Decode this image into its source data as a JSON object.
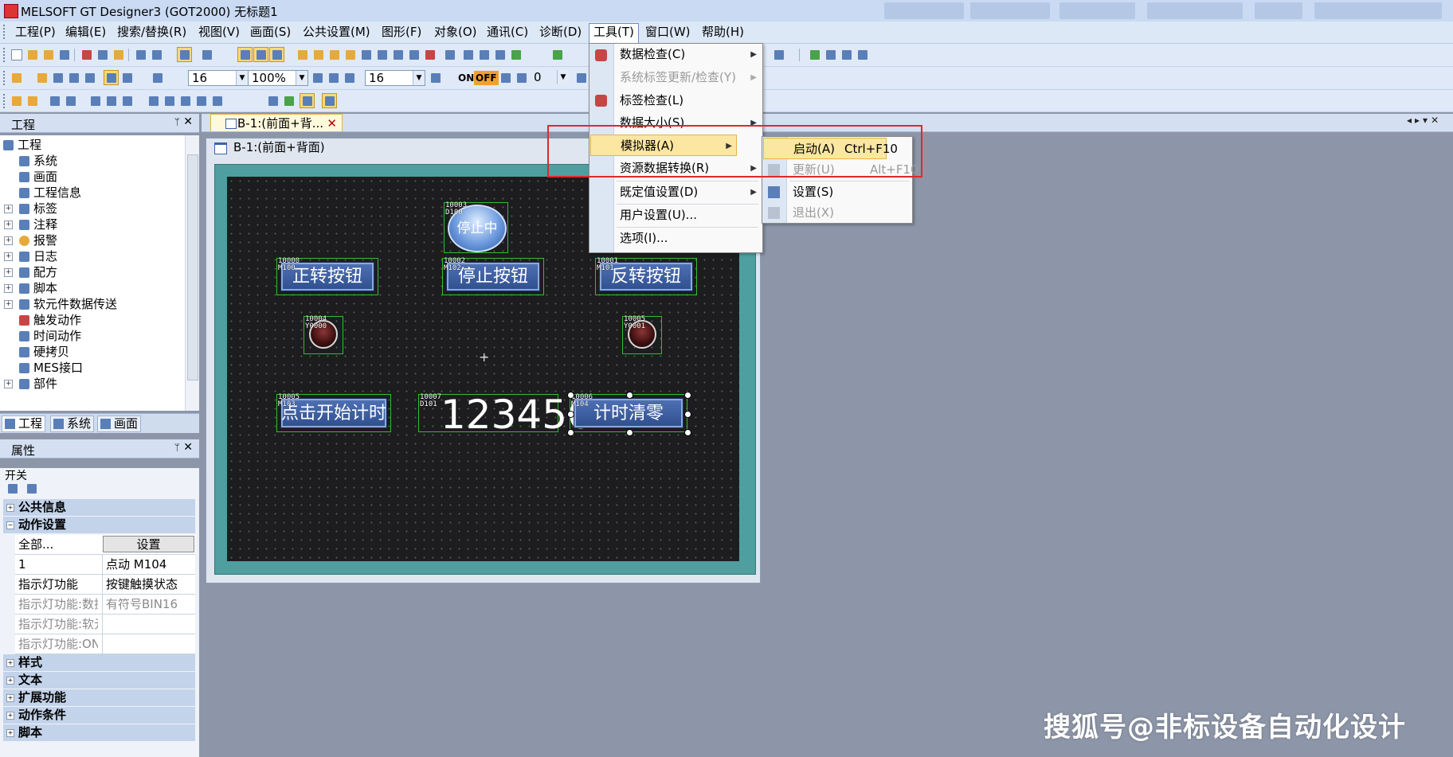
{
  "window": {
    "title": "MELSOFT GT Designer3 (GOT2000) 无标题1"
  },
  "menubar": [
    "工程(P)",
    "编辑(E)",
    "搜索/替换(R)",
    "视图(V)",
    "画面(S)",
    "公共设置(M)",
    "图形(F)",
    "对象(O)",
    "通讯(C)",
    "诊断(D)",
    "工具(T)",
    "窗口(W)",
    "帮助(H)"
  ],
  "toolbar": {
    "font_size_1": "16",
    "zoom": "100%",
    "font_size_2": "16",
    "on_label": "ON",
    "off_label": "OFF",
    "step_value": "0"
  },
  "project_panel": {
    "title": "工程",
    "root": "工程",
    "items": [
      "系统",
      "画面",
      "工程信息",
      "标签",
      "注释",
      "报警",
      "日志",
      "配方",
      "脚本",
      "软元件数据传送",
      "触发动作",
      "时间动作",
      "硬拷贝",
      "MES接口",
      "部件"
    ],
    "tabs": [
      "工程",
      "系统",
      "画面"
    ]
  },
  "properties_panel": {
    "title": "属性",
    "object_type": "开关",
    "categories_top": [
      "公共信息",
      "动作设置"
    ],
    "rows": [
      {
        "key": "全部...",
        "value": "设置"
      },
      {
        "key": "1",
        "value": "点动 M104"
      },
      {
        "key": "指示灯功能",
        "value": "按键触摸状态"
      },
      {
        "key": "指示灯功能:数据",
        "value": "有符号BIN16"
      },
      {
        "key": "指示灯功能:软元件",
        "value": ""
      },
      {
        "key": "指示灯功能:ON",
        "value": ""
      }
    ],
    "categories_bottom": [
      "样式",
      "文本",
      "扩展功能",
      "动作条件",
      "脚本"
    ]
  },
  "document_tab": {
    "label": "B-1:(前面+背..."
  },
  "screen_window": {
    "title": "B-1:(前面+背面)"
  },
  "hmi_objects": {
    "stop_lamp": {
      "tag": "10003\nD100",
      "label": "停止中"
    },
    "btn_forward": {
      "tag": "10000\nM100",
      "label": "正转按钮"
    },
    "btn_stop": {
      "tag": "10002\nM102",
      "label": "停止按钮"
    },
    "btn_reverse": {
      "tag": "10001\nM101",
      "label": "反转按钮"
    },
    "lamp_y0": {
      "tag": "10004\nY0000"
    },
    "lamp_y1": {
      "tag": "10005\nY0001"
    },
    "btn_timer_start": {
      "tag": "10005\nM103",
      "label": "点击开始计时"
    },
    "num_display": {
      "tag": "10007\nD101",
      "value": "123456"
    },
    "btn_timer_clear": {
      "tag": "10006\nM104",
      "label": "计时清零"
    }
  },
  "tools_menu": {
    "items": [
      {
        "label": "数据检查(C)",
        "submenu": true,
        "disabled": false
      },
      {
        "label": "系统标签更新/检查(Y)",
        "submenu": true,
        "disabled": true
      },
      {
        "label": "标签检查(L)",
        "submenu": false,
        "disabled": false
      },
      {
        "label": "数据大小(S)",
        "submenu": true,
        "disabled": false
      },
      {
        "label": "模拟器(A)",
        "submenu": true,
        "disabled": false,
        "highlighted": true
      },
      {
        "label": "资源数据转换(R)",
        "submenu": true,
        "disabled": false
      },
      {
        "label": "既定值设置(D)",
        "submenu": true,
        "disabled": false
      },
      {
        "label": "用户设置(U)...",
        "submenu": false,
        "disabled": false
      },
      {
        "label": "选项(I)...",
        "submenu": false,
        "disabled": false
      }
    ]
  },
  "simulator_submenu": {
    "items": [
      {
        "label": "启动(A)",
        "shortcut": "Ctrl+F10",
        "disabled": false,
        "highlighted": true
      },
      {
        "label": "更新(U)",
        "shortcut": "Alt+F10",
        "disabled": true
      },
      {
        "label": "设置(S)",
        "shortcut": "",
        "disabled": false
      },
      {
        "label": "退出(X)",
        "shortcut": "",
        "disabled": true
      }
    ]
  },
  "watermark": "搜狐号@非标设备自动化设计",
  "colors": {
    "highlight": "#fbe6a2",
    "annotation_red": "#e0282a",
    "hmi_button": "#3a5da0",
    "screen_bg": "#1d1d1f"
  }
}
